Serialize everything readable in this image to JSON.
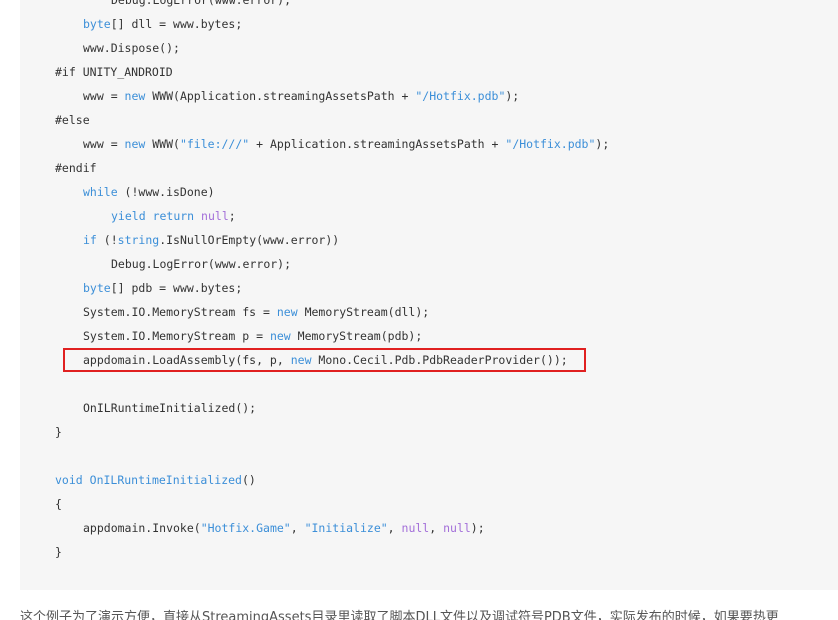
{
  "code": {
    "lines": [
      {
        "indent": 2,
        "tokens": [
          {
            "t": "Debug.LogError(www.error);",
            "c": "plain"
          }
        ]
      },
      {
        "indent": 1,
        "tokens": [
          {
            "t": "byte",
            "c": "kw"
          },
          {
            "t": "[] dll = www.bytes;",
            "c": "plain"
          }
        ]
      },
      {
        "indent": 1,
        "tokens": [
          {
            "t": "www.Dispose();",
            "c": "plain"
          }
        ]
      },
      {
        "indent": 0,
        "tokens": [
          {
            "t": "#if UNITY_ANDROID",
            "c": "pre"
          }
        ]
      },
      {
        "indent": 1,
        "tokens": [
          {
            "t": "www = ",
            "c": "plain"
          },
          {
            "t": "new",
            "c": "kw"
          },
          {
            "t": " WWW(Application.streamingAssetsPath + ",
            "c": "plain"
          },
          {
            "t": "\"/Hotfix.pdb\"",
            "c": "str"
          },
          {
            "t": ");",
            "c": "plain"
          }
        ]
      },
      {
        "indent": 0,
        "tokens": [
          {
            "t": "#else",
            "c": "pre"
          }
        ]
      },
      {
        "indent": 1,
        "tokens": [
          {
            "t": "www = ",
            "c": "plain"
          },
          {
            "t": "new",
            "c": "kw"
          },
          {
            "t": " WWW(",
            "c": "plain"
          },
          {
            "t": "\"file:///\"",
            "c": "str"
          },
          {
            "t": " + Application.streamingAssetsPath + ",
            "c": "plain"
          },
          {
            "t": "\"/Hotfix.pdb\"",
            "c": "str"
          },
          {
            "t": ");",
            "c": "plain"
          }
        ]
      },
      {
        "indent": 0,
        "tokens": [
          {
            "t": "#endif",
            "c": "pre"
          }
        ]
      },
      {
        "indent": 1,
        "tokens": [
          {
            "t": "while",
            "c": "kw"
          },
          {
            "t": " (!www.isDone)",
            "c": "plain"
          }
        ]
      },
      {
        "indent": 2,
        "tokens": [
          {
            "t": "yield",
            "c": "kw"
          },
          {
            "t": " ",
            "c": "plain"
          },
          {
            "t": "return",
            "c": "kw"
          },
          {
            "t": " ",
            "c": "plain"
          },
          {
            "t": "null",
            "c": "lit"
          },
          {
            "t": ";",
            "c": "plain"
          }
        ]
      },
      {
        "indent": 1,
        "tokens": [
          {
            "t": "if",
            "c": "kw"
          },
          {
            "t": " (!",
            "c": "plain"
          },
          {
            "t": "string",
            "c": "kw"
          },
          {
            "t": ".IsNullOrEmpty(www.error))",
            "c": "plain"
          }
        ]
      },
      {
        "indent": 2,
        "tokens": [
          {
            "t": "Debug.LogError(www.error);",
            "c": "plain"
          }
        ]
      },
      {
        "indent": 1,
        "tokens": [
          {
            "t": "byte",
            "c": "kw"
          },
          {
            "t": "[] pdb = www.bytes;",
            "c": "plain"
          }
        ]
      },
      {
        "indent": 1,
        "tokens": [
          {
            "t": "System.IO.MemoryStream fs = ",
            "c": "plain"
          },
          {
            "t": "new",
            "c": "kw"
          },
          {
            "t": " MemoryStream(dll);",
            "c": "plain"
          }
        ]
      },
      {
        "indent": 1,
        "tokens": [
          {
            "t": "System.IO.MemoryStream p = ",
            "c": "plain"
          },
          {
            "t": "new",
            "c": "kw"
          },
          {
            "t": " MemoryStream(pdb);",
            "c": "plain"
          }
        ]
      },
      {
        "indent": 1,
        "tokens": [
          {
            "t": "appdomain.LoadAssembly(fs, p, ",
            "c": "plain"
          },
          {
            "t": "new",
            "c": "kw"
          },
          {
            "t": " Mono.Cecil.Pdb.PdbReaderProvider());",
            "c": "plain"
          }
        ]
      },
      {
        "indent": 0,
        "tokens": []
      },
      {
        "indent": 1,
        "tokens": [
          {
            "t": "OnILRuntimeInitialized();",
            "c": "plain"
          }
        ]
      },
      {
        "indent": 0,
        "tokens": [
          {
            "t": "}",
            "c": "plain"
          }
        ]
      },
      {
        "indent": 0,
        "tokens": []
      },
      {
        "indent": 0,
        "tokens": [
          {
            "t": "void",
            "c": "kw"
          },
          {
            "t": " ",
            "c": "plain"
          },
          {
            "t": "OnILRuntimeInitialized",
            "c": "kw"
          },
          {
            "t": "()",
            "c": "plain"
          }
        ]
      },
      {
        "indent": 0,
        "tokens": [
          {
            "t": "{",
            "c": "plain"
          }
        ]
      },
      {
        "indent": 1,
        "tokens": [
          {
            "t": "appdomain.Invoke(",
            "c": "plain"
          },
          {
            "t": "\"Hotfix.Game\"",
            "c": "str"
          },
          {
            "t": ", ",
            "c": "plain"
          },
          {
            "t": "\"Initialize\"",
            "c": "str"
          },
          {
            "t": ", ",
            "c": "plain"
          },
          {
            "t": "null",
            "c": "lit"
          },
          {
            "t": ", ",
            "c": "plain"
          },
          {
            "t": "null",
            "c": "lit"
          },
          {
            "t": ");",
            "c": "plain"
          }
        ]
      },
      {
        "indent": 0,
        "tokens": [
          {
            "t": "}",
            "c": "plain"
          }
        ]
      }
    ],
    "highlighted_line": 15,
    "colors": {
      "keyword": "#3c8fd8",
      "string": "#3c8fd8",
      "literal": "#a36fd9",
      "plain": "#333333",
      "highlight_border": "#e02020",
      "panel_bg": "#f6f6f6"
    }
  },
  "bottom_text": "这个例子为了演示方便，直接从StreamingAssets目录里读取了脚本DLL文件以及调试符号PDB文件，实际发布的时候，如果要热更"
}
